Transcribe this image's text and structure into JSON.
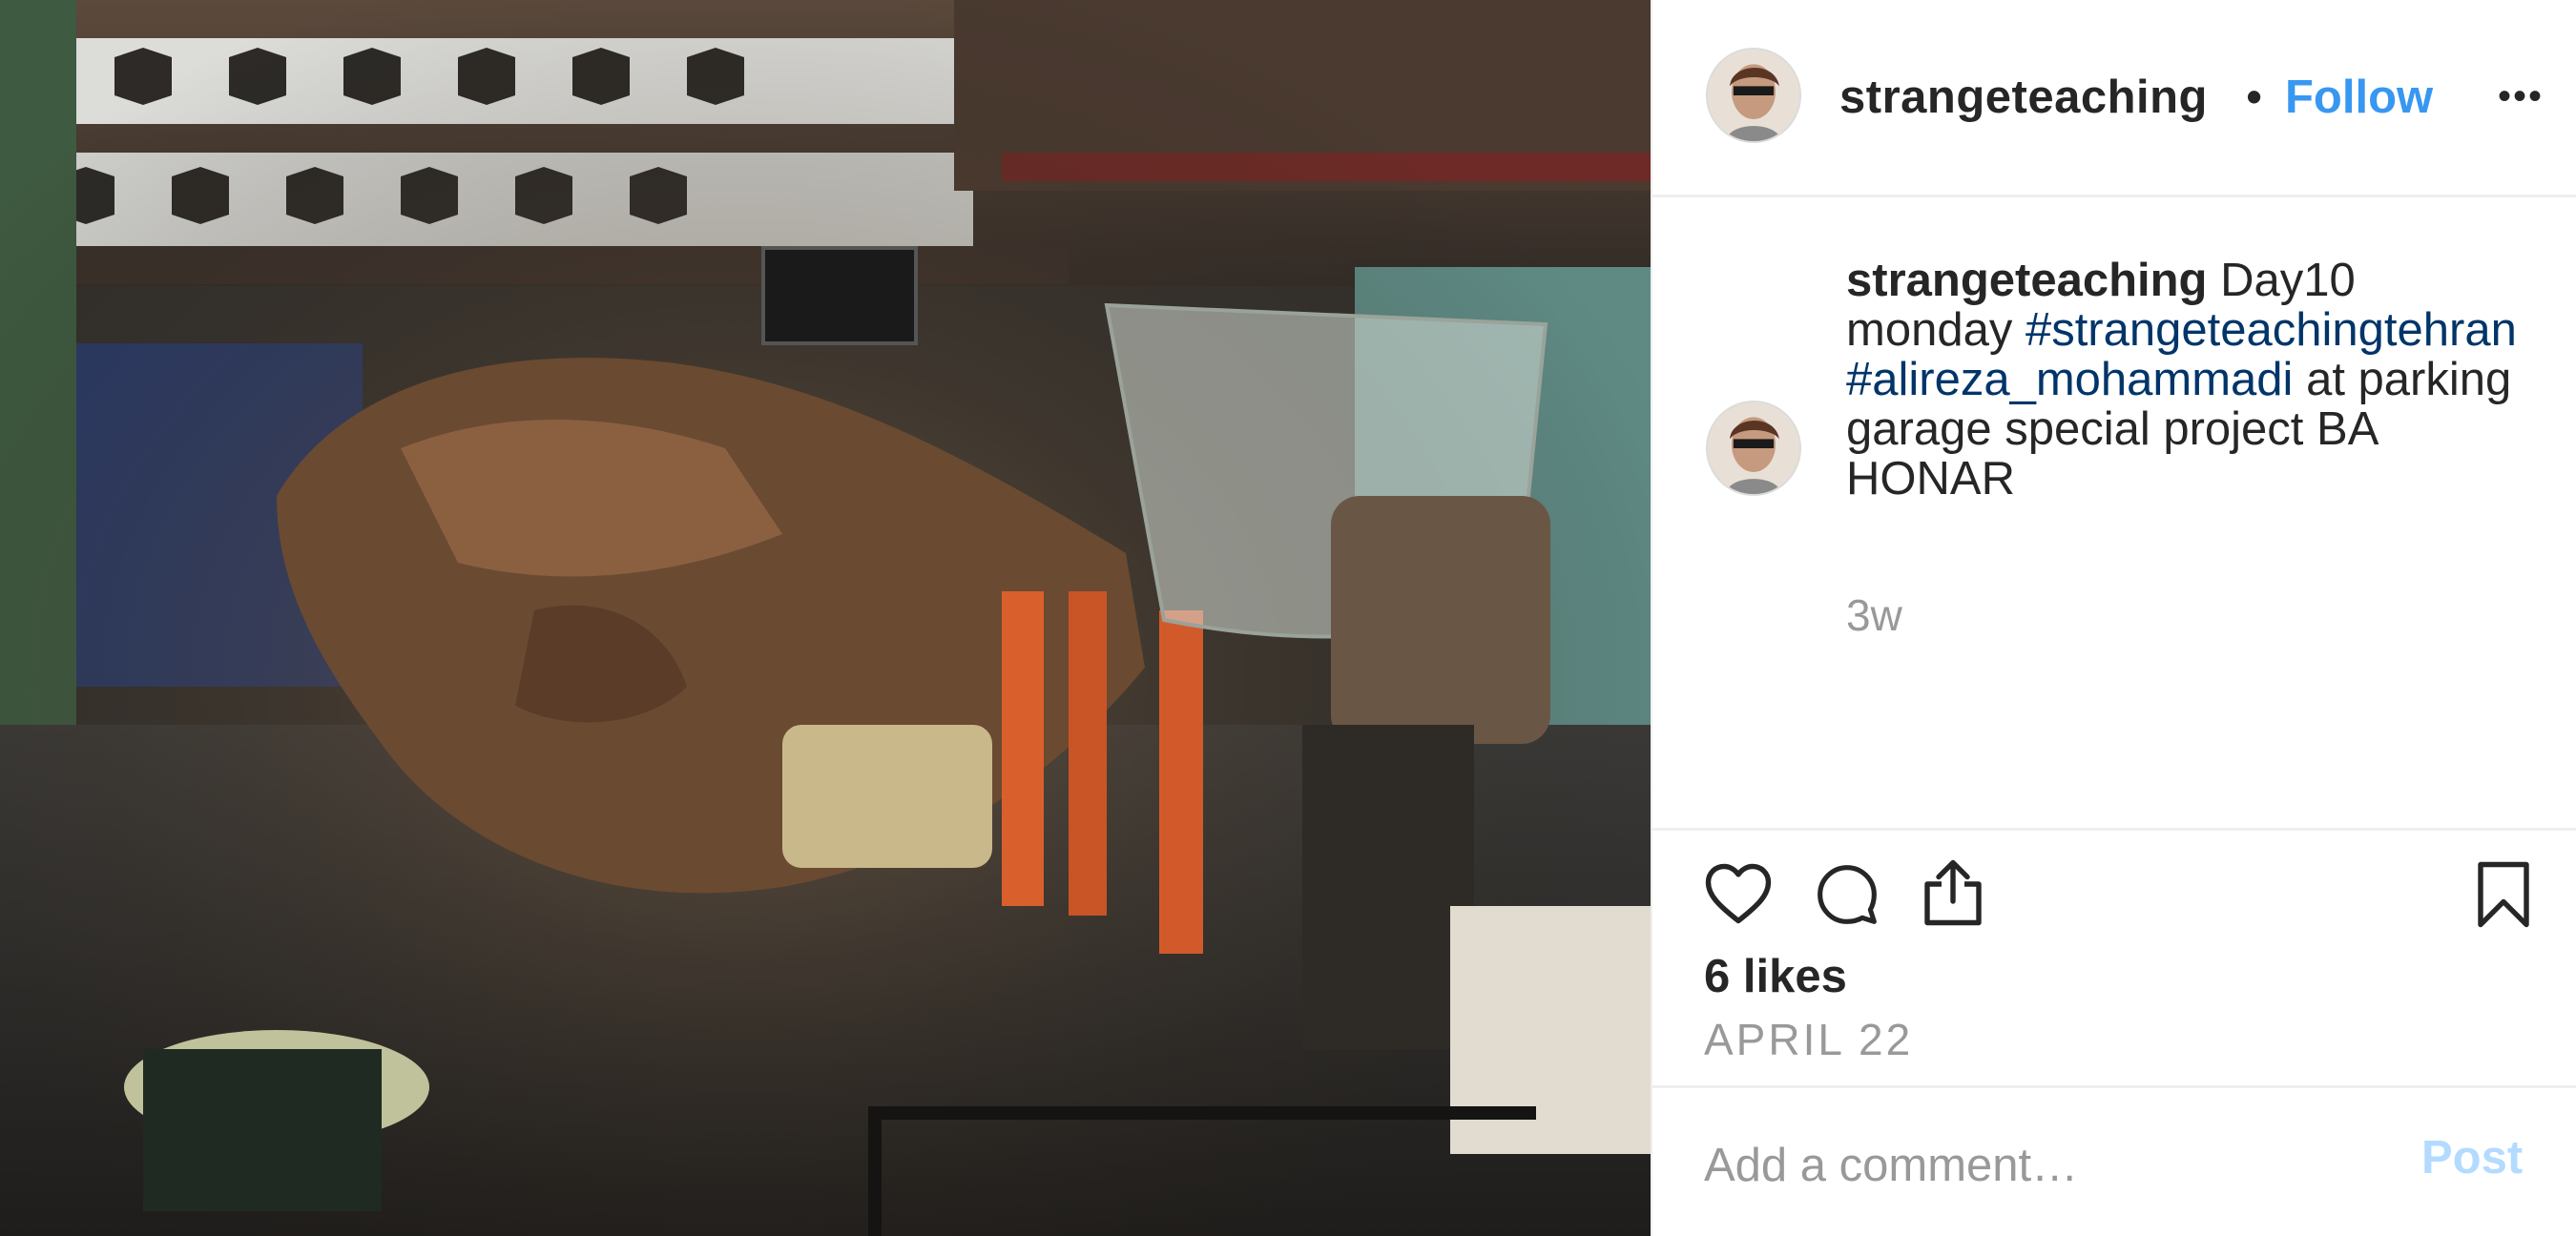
{
  "post": {
    "image": {
      "description_icon": "photo-icon"
    },
    "header": {
      "username": "strangeteaching",
      "separator": "•",
      "follow_label": "Follow",
      "more_label": "•••"
    },
    "caption": {
      "username": "strangeteaching",
      "text_1": " Day10 monday ",
      "hashtag_1": "#strangeteachingtehran",
      "hashtag_2": "#alireza_mohammadi",
      "text_2": " at parking garage special project BA HONAR",
      "time": "3w"
    },
    "actions": {
      "like_icon": "heart-icon",
      "comment_icon": "comment-icon",
      "share_icon": "share-icon",
      "save_icon": "bookmark-icon"
    },
    "likes": "6 likes",
    "date": "APRIL 22",
    "comment": {
      "placeholder": "Add a comment…",
      "post_label": "Post"
    }
  },
  "colors": {
    "accent": "#3897f0",
    "hashtag": "#003569",
    "muted": "#999999",
    "post_disabled": "#b3dbff",
    "text": "#262626"
  }
}
